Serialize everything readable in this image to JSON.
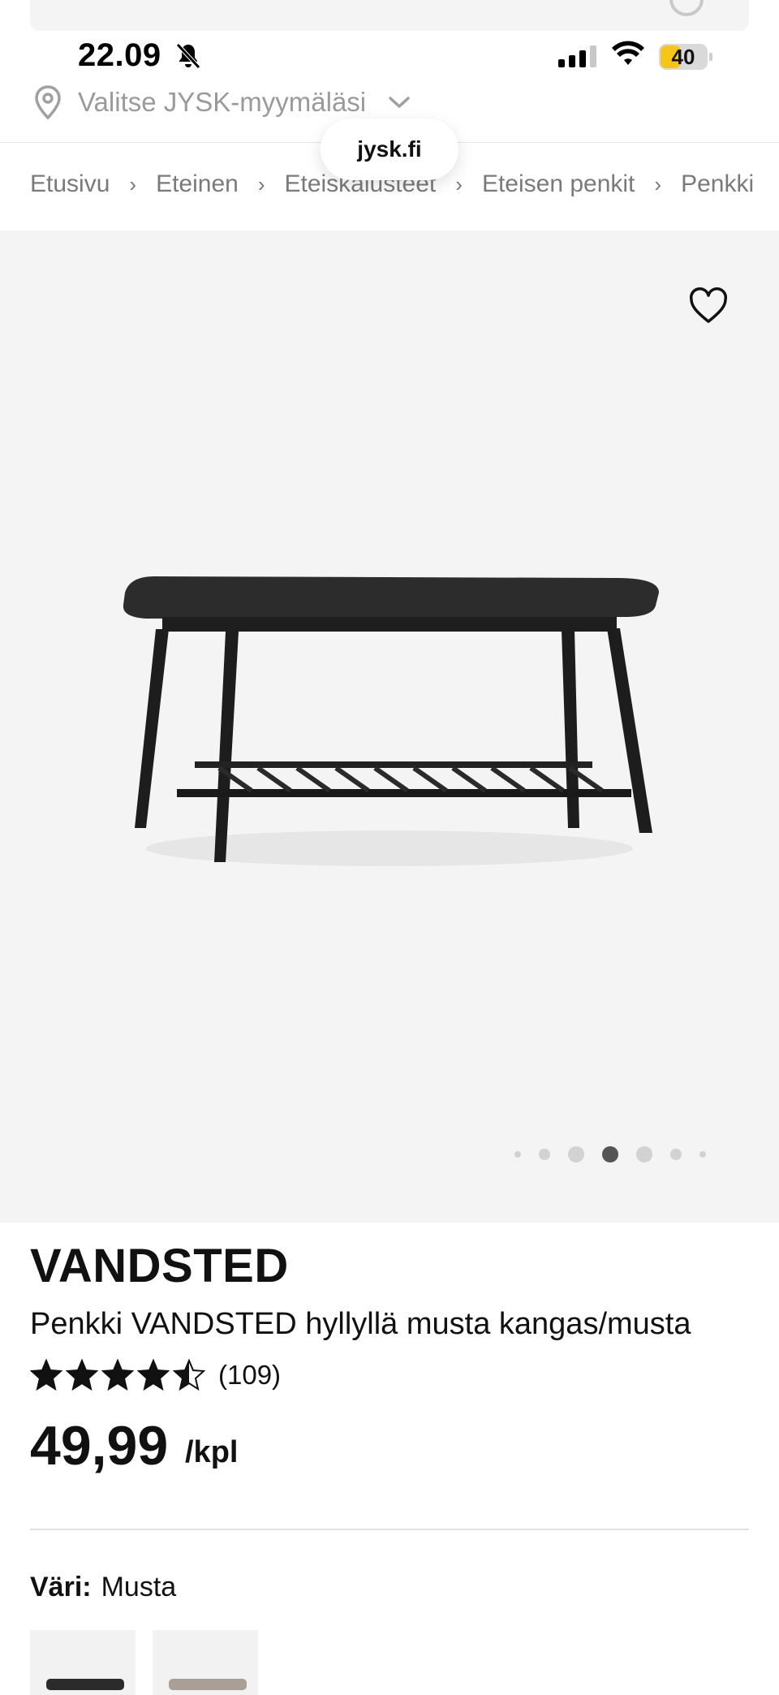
{
  "status_bar": {
    "time": "22.09",
    "battery": "40",
    "icons": [
      "bell-muted-icon",
      "cellular-signal-icon",
      "wifi-icon",
      "battery-icon"
    ]
  },
  "store_selector": {
    "label": "Valitse JYSK-myymäläsi",
    "icons": [
      "location-pin-icon",
      "chevron-down-icon"
    ]
  },
  "browser": {
    "url": "jysk.fi"
  },
  "breadcrumb": {
    "items": [
      "Etusivu",
      "Eteinen",
      "Eteiskalusteet",
      "Eteisen penkit",
      "Penkki"
    ],
    "separator": "›"
  },
  "gallery": {
    "dots_count": 7,
    "active_dot": 3,
    "background": "#f4f4f4",
    "icons": [
      "heart-icon"
    ]
  },
  "product": {
    "brand": "VANDSTED",
    "title": "Penkki VANDSTED hyllyllä musta kangas/musta",
    "rating_value": 4.5,
    "rating_max": 5,
    "rating_count": "(109)",
    "price": "49,99",
    "unit": "/kpl"
  },
  "variant": {
    "label": "Väri:",
    "value": "Musta",
    "swatch_colors": [
      "#2b2b2b",
      "#a8a096"
    ]
  }
}
